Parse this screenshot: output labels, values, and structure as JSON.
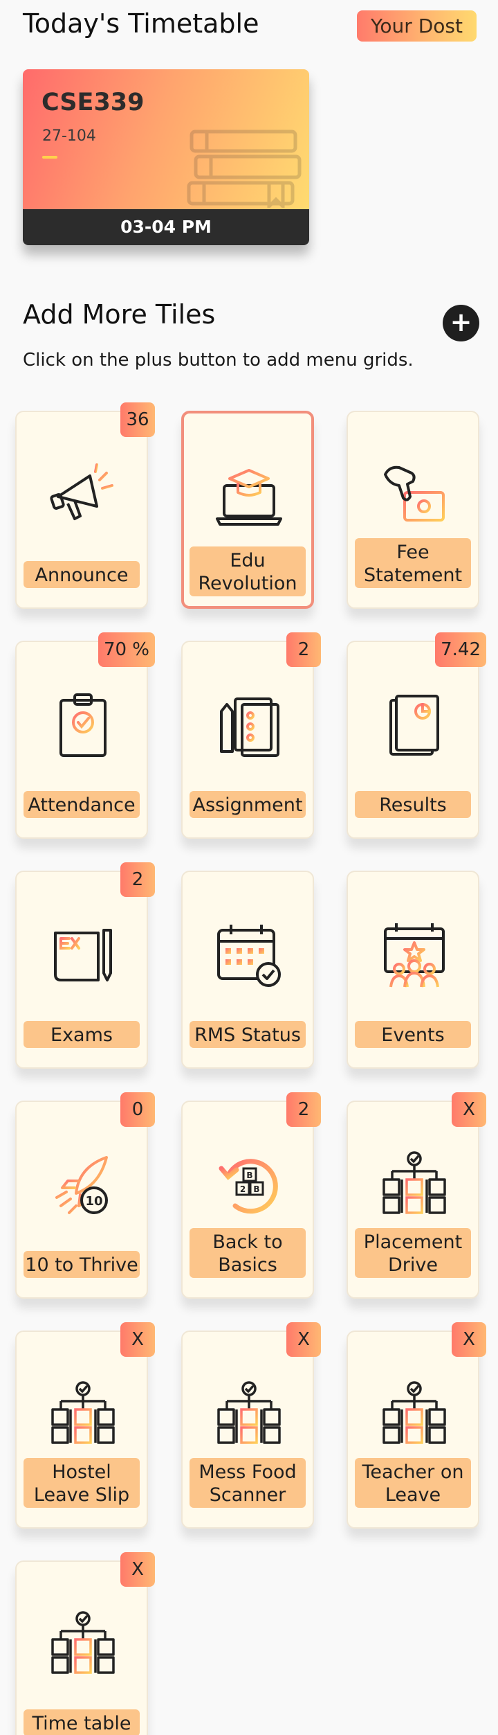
{
  "header": {
    "title": "Today's Timetable",
    "brand": "Your Dost"
  },
  "timetable": {
    "course": "CSE339",
    "room": "27-104",
    "time": "03-04 PM"
  },
  "section": {
    "title": "Add More Tiles",
    "hint": "Click on the plus button to add menu grids.",
    "add_button": "+"
  },
  "colors": {
    "accent_start": "#ff7b6b",
    "accent_end": "#ffd96f",
    "tile_label": "#fcc58a",
    "tile_bg": "#fffaeb",
    "dark": "#2c2c2c"
  },
  "tiles": [
    {
      "label": "Announce",
      "badge": "36",
      "icon": "megaphone-icon"
    },
    {
      "label": "Edu Revolution",
      "badge": "",
      "icon": "graduation-laptop-icon",
      "active": true
    },
    {
      "label": "Fee Statement",
      "badge": "",
      "icon": "hand-money-icon"
    },
    {
      "label": "Attendance",
      "badge": "70 %",
      "icon": "clipboard-check-icon"
    },
    {
      "label": "Assignment",
      "badge": "2",
      "icon": "checklist-pencil-icon"
    },
    {
      "label": "Results",
      "badge": "7.42",
      "icon": "report-chart-icon"
    },
    {
      "label": "Exams",
      "badge": "2",
      "icon": "exam-paper-icon"
    },
    {
      "label": "RMS Status",
      "badge": "",
      "icon": "calendar-check-icon"
    },
    {
      "label": "Events",
      "badge": "",
      "icon": "calendar-people-icon"
    },
    {
      "label": "10 to Thrive",
      "badge": "0",
      "icon": "rocket-icon"
    },
    {
      "label": "Back to Basics",
      "badge": "2",
      "icon": "blocks-refresh-icon"
    },
    {
      "label": "Placement Drive",
      "badge": "X",
      "icon": "hierarchy-icon"
    },
    {
      "label": "Hostel Leave Slip",
      "badge": "X",
      "icon": "hierarchy-icon"
    },
    {
      "label": "Mess Food Scanner",
      "badge": "X",
      "icon": "hierarchy-icon"
    },
    {
      "label": "Teacher on Leave",
      "badge": "X",
      "icon": "hierarchy-icon"
    },
    {
      "label": "Time table",
      "badge": "X",
      "icon": "hierarchy-icon"
    }
  ]
}
